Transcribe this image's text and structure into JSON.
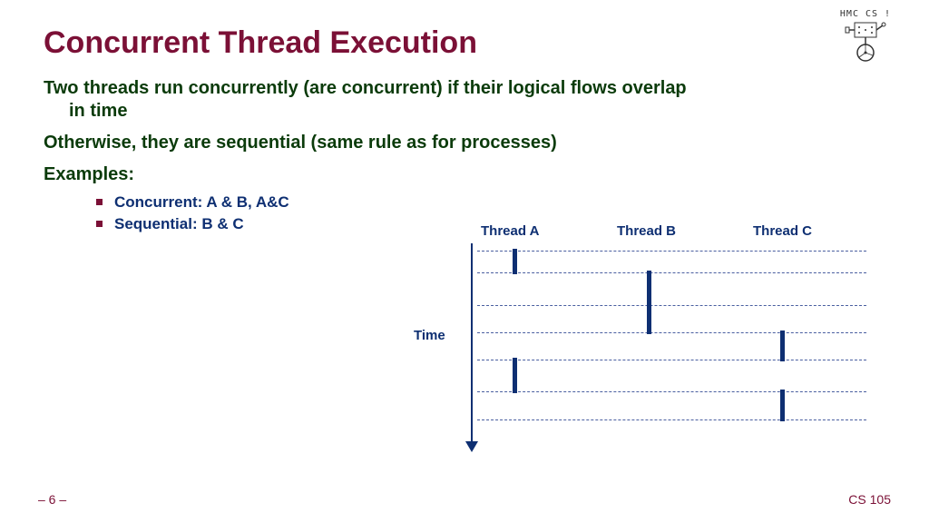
{
  "slide": {
    "title": "Concurrent Thread Execution",
    "line1a": "Two threads run concurrently (are concurrent) if their logical flows overlap",
    "line1b": "in time",
    "line2": "Otherwise, they are sequential  (same rule as for processes)",
    "examples_label": "Examples:",
    "bullet1": "Concurrent: A & B, A&C",
    "bullet2": "Sequential: B & C"
  },
  "diagram": {
    "threadA": "Thread A",
    "threadB": "Thread B",
    "threadC": "Thread C",
    "time": "Time",
    "row_y": [
      30,
      54,
      90,
      120,
      150,
      185,
      216
    ],
    "columns": {
      "A": 135,
      "B": 283,
      "C": 430
    },
    "bars": [
      {
        "col": "A",
        "from": 0,
        "to": 1
      },
      {
        "col": "B",
        "from": 1,
        "to": 3
      },
      {
        "col": "C",
        "from": 3,
        "to": 4
      },
      {
        "col": "A",
        "from": 4,
        "to": 5
      },
      {
        "col": "C",
        "from": 5,
        "to": 6
      }
    ]
  },
  "footer": {
    "page": "– 6 –",
    "course": "CS 105"
  },
  "logo": {
    "text1": "HMC CS !"
  }
}
